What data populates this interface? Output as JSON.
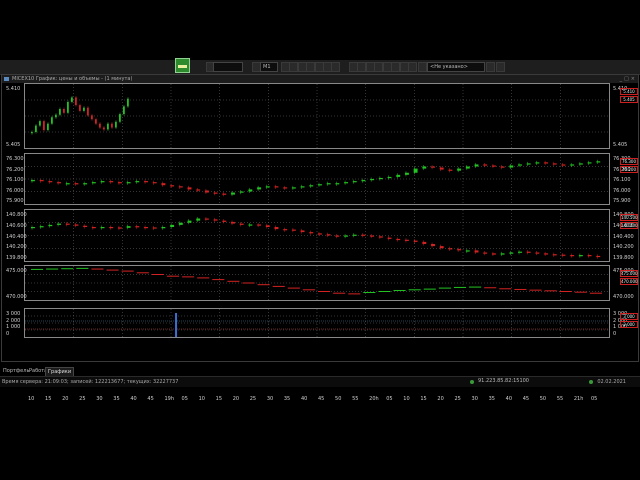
{
  "window": {
    "title": "MICEX10 График: цены и объемы - (1 минута)"
  },
  "toolbar": {
    "timeframe": "M1",
    "filter": "<Не указано>",
    "logo_icon": "trading-terminal-logo"
  },
  "tabs": [
    {
      "label": "Портфель",
      "active": false
    },
    {
      "label": "Работа",
      "active": false
    },
    {
      "label": "Графики",
      "active": true
    }
  ],
  "status": {
    "text": "Время сервера: 21:09:03; записей: 122213677; текущих: 32227737",
    "server": "91.223.85.82:15100",
    "date": "02.02.2021"
  },
  "colors": {
    "up": "#22c322",
    "down": "#d42222",
    "grid": "#6a6a6a"
  },
  "chart_data": [
    {
      "type": "candlestick",
      "panel": "1",
      "y_ticks": [
        "5.410",
        "5.405"
      ],
      "price_flags": [
        "5.410",
        "5.405"
      ],
      "ylim": [
        5.402,
        5.412
      ],
      "values": [
        5.4045,
        5.4055,
        5.4062,
        5.4048,
        5.4058,
        5.4068,
        5.4072,
        5.4081,
        5.4075,
        5.4092,
        5.4099,
        5.4087,
        5.4078,
        5.4083,
        5.4071,
        5.4065,
        5.4058,
        5.4052,
        5.4049,
        5.4058,
        5.4052,
        5.4061,
        5.4073,
        5.4085,
        5.4097
      ]
    },
    {
      "type": "candlestick",
      "panel": "2",
      "y_ticks": [
        "76.300",
        "76.200",
        "76.100",
        "76.000",
        "75.900"
      ],
      "price_flags": [
        "76.300",
        "76.200"
      ],
      "ylim": [
        75.86,
        76.34
      ],
      "values": [
        76.09,
        76.08,
        76.07,
        76.06,
        76.06,
        76.05,
        76.06,
        76.07,
        76.08,
        76.07,
        76.06,
        76.07,
        76.08,
        76.07,
        76.06,
        76.04,
        76.03,
        76.02,
        76.0,
        75.99,
        75.97,
        75.96,
        75.95,
        75.97,
        75.98,
        76.0,
        76.02,
        76.03,
        76.02,
        76.01,
        76.02,
        76.03,
        76.04,
        76.05,
        76.06,
        76.06,
        76.07,
        76.08,
        76.09,
        76.1,
        76.11,
        76.12,
        76.14,
        76.16,
        76.2,
        76.22,
        76.21,
        76.19,
        76.18,
        76.2,
        76.22,
        76.24,
        76.23,
        76.22,
        76.21,
        76.23,
        76.24,
        76.25,
        76.26,
        76.25,
        76.24,
        76.23,
        76.24,
        76.25,
        76.26,
        76.27
      ]
    },
    {
      "type": "candlestick",
      "panel": "3",
      "y_ticks": [
        "140.800",
        "140.600",
        "140.400",
        "140.200",
        "139.800"
      ],
      "price_flags": [
        "140.500",
        "140.200"
      ],
      "ylim": [
        139.7,
        140.9
      ],
      "values": [
        140.5,
        140.52,
        140.55,
        140.58,
        140.56,
        140.53,
        140.5,
        140.48,
        140.5,
        140.49,
        140.48,
        140.52,
        140.5,
        140.49,
        140.47,
        140.5,
        140.55,
        140.6,
        140.65,
        140.7,
        140.68,
        140.65,
        140.62,
        140.58,
        140.55,
        140.56,
        140.54,
        140.5,
        140.45,
        140.44,
        140.42,
        140.38,
        140.35,
        140.33,
        140.3,
        140.28,
        140.3,
        140.32,
        140.3,
        140.28,
        140.25,
        140.22,
        140.2,
        140.18,
        140.15,
        140.1,
        140.05,
        140.0,
        139.98,
        139.95,
        139.95,
        139.9,
        139.88,
        139.85,
        139.88,
        139.9,
        139.92,
        139.9,
        139.88,
        139.86,
        139.85,
        139.84,
        139.83,
        139.84,
        139.82,
        139.81
      ]
    },
    {
      "type": "line",
      "panel": "4",
      "y_ticks": [
        "475.000",
        "470.000"
      ],
      "price_flags": [
        "475.000",
        "470.000"
      ],
      "ylim": [
        467,
        477
      ],
      "values": [
        476.0,
        476.1,
        476.2,
        476.3,
        476.1,
        475.8,
        475.5,
        475.0,
        474.5,
        474.0,
        473.8,
        473.5,
        473.0,
        472.5,
        472.0,
        471.5,
        471.0,
        470.5,
        470.0,
        469.5,
        469.0,
        468.8,
        469.2,
        469.5,
        469.8,
        470.0,
        470.2,
        470.5,
        470.7,
        470.8,
        470.6,
        470.3,
        470.1,
        469.9,
        469.7,
        469.5,
        469.3,
        469.0
      ]
    },
    {
      "type": "volume",
      "panel": "5",
      "y_ticks": [
        "3 000",
        "2 000",
        "1 000",
        "0"
      ],
      "price_flags": [
        "3 000",
        "2 000"
      ],
      "ylim": [
        0,
        3500
      ],
      "markers": [
        {
          "x": 30,
          "value": 3000
        }
      ]
    }
  ],
  "time_axis": [
    "10",
    "15",
    "20",
    "25",
    "30",
    "35",
    "40",
    "45",
    "19h",
    "05",
    "10",
    "15",
    "20",
    "25",
    "30",
    "35",
    "40",
    "45",
    "50",
    "55",
    "20h",
    "05",
    "10",
    "15",
    "20",
    "25",
    "30",
    "35",
    "40",
    "45",
    "50",
    "55",
    "21h",
    "05"
  ]
}
